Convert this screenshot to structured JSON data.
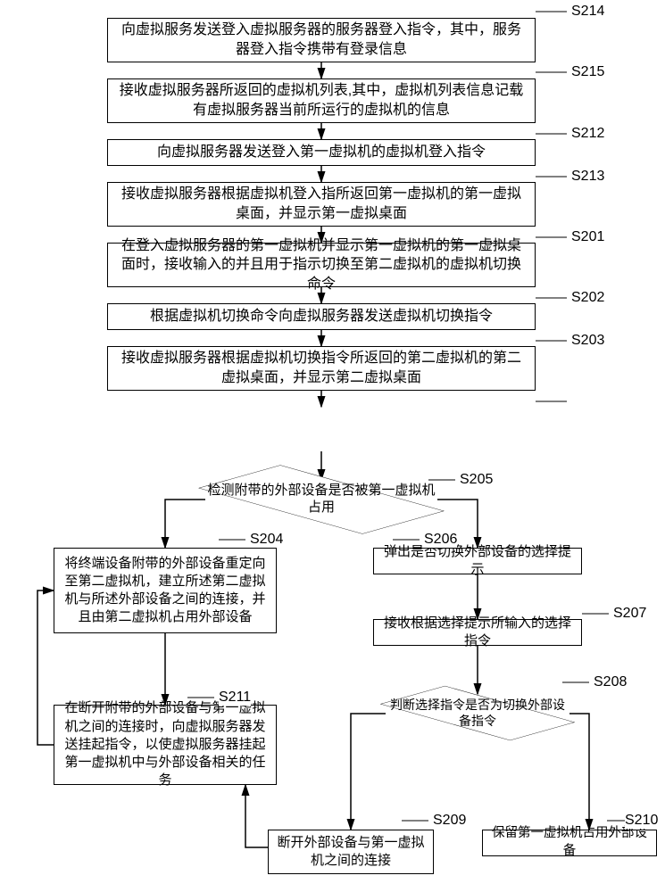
{
  "chart_data": {
    "type": "flowchart",
    "nodes": [
      {
        "id": "S214",
        "kind": "process",
        "text": "向虚拟服务发送登入虚拟服务器的服务器登入指令，其中，服务器登入指令携带有登录信息"
      },
      {
        "id": "S215",
        "kind": "process",
        "text": "接收虚拟服务器所返回的虚拟机列表,其中，虚拟机列表信息记载有虚拟服务器当前所运行的虚拟机的信息"
      },
      {
        "id": "S212",
        "kind": "process",
        "text": "向虚拟服务器发送登入第一虚拟机的虚拟机登入指令"
      },
      {
        "id": "S213",
        "kind": "process",
        "text": "接收虚拟服务器根据虚拟机登入指所返回第一虚拟机的第一虚拟桌面，并显示第一虚拟桌面"
      },
      {
        "id": "S201",
        "kind": "process",
        "text": "在登入虚拟服务器的第一虚拟机并显示第一虚拟机的第一虚拟桌面时，接收输入的并且用于指示切换至第二虚拟机的虚拟机切换命令"
      },
      {
        "id": "S202",
        "kind": "process",
        "text": "根据虚拟机切换命令向虚拟服务器发送虚拟机切换指令"
      },
      {
        "id": "S203",
        "kind": "process",
        "text": "接收虚拟服务器根据虚拟机切换指令所返回的第二虚拟机的第二虚拟桌面，并显示第二虚拟桌面"
      },
      {
        "id": "S205",
        "kind": "decision",
        "text": "检测附带的外部设备是否被第一虚拟机占用"
      },
      {
        "id": "S204",
        "kind": "process",
        "text": "将终端设备附带的外部设备重定向至第二虚拟机，建立所述第二虚拟机与所述外部设备之间的连接，并且由第二虚拟机占用外部设备"
      },
      {
        "id": "S206",
        "kind": "process",
        "text": "弹出是否切换外部设备的选择提示"
      },
      {
        "id": "S207",
        "kind": "process",
        "text": "接收根据选择提示所输入的选择指令"
      },
      {
        "id": "S208",
        "kind": "decision",
        "text": "判断选择指令是否为切换外部设备指令"
      },
      {
        "id": "S211",
        "kind": "process",
        "text": "在断开附带的外部设备与第一虚拟机之间的连接时，向虚拟服务器发送挂起指令，以使虚拟服务器挂起第一虚拟机中与外部设备相关的任务"
      },
      {
        "id": "S209",
        "kind": "process",
        "text": "断开外部设备与第一虚拟机之间的连接"
      },
      {
        "id": "S210",
        "kind": "process",
        "text": "保留第一虚拟机占用外部设备"
      }
    ],
    "edges": [
      {
        "from": "S214",
        "to": "S215"
      },
      {
        "from": "S215",
        "to": "S212"
      },
      {
        "from": "S212",
        "to": "S213"
      },
      {
        "from": "S213",
        "to": "S201"
      },
      {
        "from": "S201",
        "to": "S202"
      },
      {
        "from": "S202",
        "to": "S203"
      },
      {
        "from": "S203",
        "to": "S205"
      },
      {
        "from": "S205",
        "to": "S204"
      },
      {
        "from": "S205",
        "to": "S206"
      },
      {
        "from": "S206",
        "to": "S207"
      },
      {
        "from": "S207",
        "to": "S208"
      },
      {
        "from": "S208",
        "to": "S209"
      },
      {
        "from": "S208",
        "to": "S210"
      },
      {
        "from": "S209",
        "to": "S211"
      },
      {
        "from": "S211",
        "to": "S204"
      }
    ]
  },
  "labels": {
    "S214": "S214",
    "S215": "S215",
    "S212": "S212",
    "S213": "S213",
    "S201": "S201",
    "S202": "S202",
    "S203": "S203",
    "S205": "S205",
    "S204": "S204",
    "S206": "S206",
    "S207": "S207",
    "S208": "S208",
    "S211": "S211",
    "S209": "S209",
    "S210": "S210"
  },
  "text": {
    "S214": "向虚拟服务发送登入虚拟服务器的服务器登入指令，其中，服务器登入指令携带有登录信息",
    "S215": "接收虚拟服务器所返回的虚拟机列表,其中，虚拟机列表信息记载有虚拟服务器当前所运行的虚拟机的信息",
    "S212": "向虚拟服务器发送登入第一虚拟机的虚拟机登入指令",
    "S213": "接收虚拟服务器根据虚拟机登入指所返回第一虚拟机的第一虚拟桌面，并显示第一虚拟桌面",
    "S201": "在登入虚拟服务器的第一虚拟机并显示第一虚拟机的第一虚拟桌面时，接收输入的并且用于指示切换至第二虚拟机的虚拟机切换命令",
    "S202": "根据虚拟机切换命令向虚拟服务器发送虚拟机切换指令",
    "S203": "接收虚拟服务器根据虚拟机切换指令所返回的第二虚拟机的第二虚拟桌面，并显示第二虚拟桌面",
    "S205": "检测附带的外部设备是否被第一虚拟机占用",
    "S204": "将终端设备附带的外部设备重定向至第二虚拟机，建立所述第二虚拟机与所述外部设备之间的连接，并且由第二虚拟机占用外部设备",
    "S206": "弹出是否切换外部设备的选择提示",
    "S207": "接收根据选择提示所输入的选择指令",
    "S208": "判断选择指令是否为切换外部设备指令",
    "S211": "在断开附带的外部设备与第一虚拟机之间的连接时，向虚拟服务器发送挂起指令，以使虚拟服务器挂起第一虚拟机中与外部设备相关的任务",
    "S209": "断开外部设备与第一虚拟机之间的连接",
    "S210": "保留第一虚拟机占用外部设备"
  }
}
